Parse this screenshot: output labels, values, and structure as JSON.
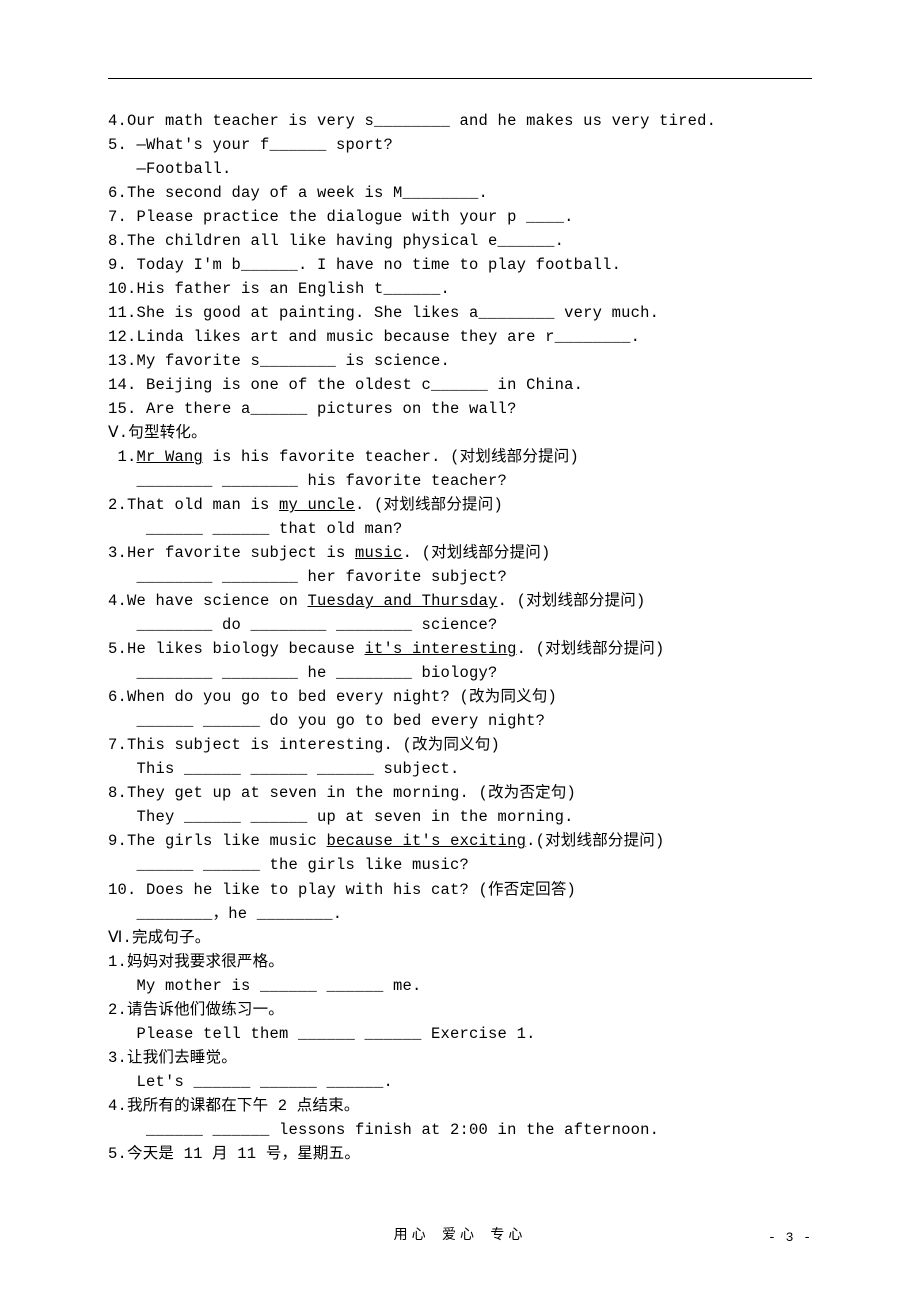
{
  "lines": {
    "l4": "4.Our math teacher is very s________ and he makes us very tired.",
    "l5a": "5. —What's your f______ sport?",
    "l5b": "   —Football.",
    "l6": "6.The second day of a week is M________.",
    "l7": "7. Please practice the dialogue with your p ____.",
    "l8": "8.The children all like having physical e______.",
    "l9": "9. Today I'm b______. I have no time to play football.",
    "l10": "10.His father is an English t______.",
    "l11": "11.She is good at painting. She likes a________ very much.",
    "l12": "12.Linda likes art and music because they are r________.",
    "l13": "13.My favorite s________ is science.",
    "l14": "14. Beijing is one of the oldest c______ in China.",
    "l15": "15. Are there a______ pictures on the wall?",
    "v_title": "Ⅴ.句型转化。",
    "v1a_pre": " 1.",
    "v1a_ul": "Mr Wang",
    "v1a_post": " is his favorite teacher. (对划线部分提问)",
    "v1b": "   ________ ________ his favorite teacher?",
    "v2a_pre": "2.That old man is ",
    "v2a_ul": "my uncle",
    "v2a_post": ". (对划线部分提问)",
    "v2b": "    ______ ______ that old man?",
    "v3a_pre": "3.Her favorite subject is ",
    "v3a_ul": "music",
    "v3a_post": ". (对划线部分提问)",
    "v3b": "   ________ ________ her favorite subject?",
    "v4a_pre": "4.We have science on ",
    "v4a_ul": "Tuesday and Thursday",
    "v4a_post": ". (对划线部分提问)",
    "v4b": "   ________ do ________ ________ science?",
    "v5a_pre": "5.He likes biology because ",
    "v5a_ul": "it's interesting",
    "v5a_post": ". (对划线部分提问)",
    "v5b": "   ________ ________ he ________ biology?",
    "v6a": "6.When do you go to bed every night? (改为同义句)",
    "v6b": "   ______ ______ do you go to bed every night?",
    "v7a": "7.This subject is interesting. (改为同义句)",
    "v7b": "   This ______ ______ ______ subject.",
    "v8a": "8.They get up at seven in the morning. (改为否定句)",
    "v8b": "   They ______ ______ up at seven in the morning.",
    "v9a_pre": "9.The girls like music ",
    "v9a_ul": "because it's exciting",
    "v9a_post": ".(对划线部分提问)",
    "v9b": "   ______ ______ the girls like music?",
    "v10a": "10. Does he like to play with his cat? (作否定回答)",
    "v10b": "   ________，he ________.",
    "vi_title": "Ⅵ.完成句子。",
    "vi1a": "1.妈妈对我要求很严格。",
    "vi1b": "   My mother is ______ ______ me.",
    "vi2a": "2.请告诉他们做练习一。",
    "vi2b": "   Please tell them ______ ______ Exercise 1.",
    "vi3a": "3.让我们去睡觉。",
    "vi3b": "   Let's ______ ______ ______.",
    "vi4a": "4.我所有的课都在下午 2 点结束。",
    "vi4b": "    ______ ______ lessons finish at 2:00 in the afternoon.",
    "vi5a": "5.今天是 11 月 11 号，星期五。"
  },
  "footer": "用心  爱心  专心",
  "pagenum": "- 3 -"
}
